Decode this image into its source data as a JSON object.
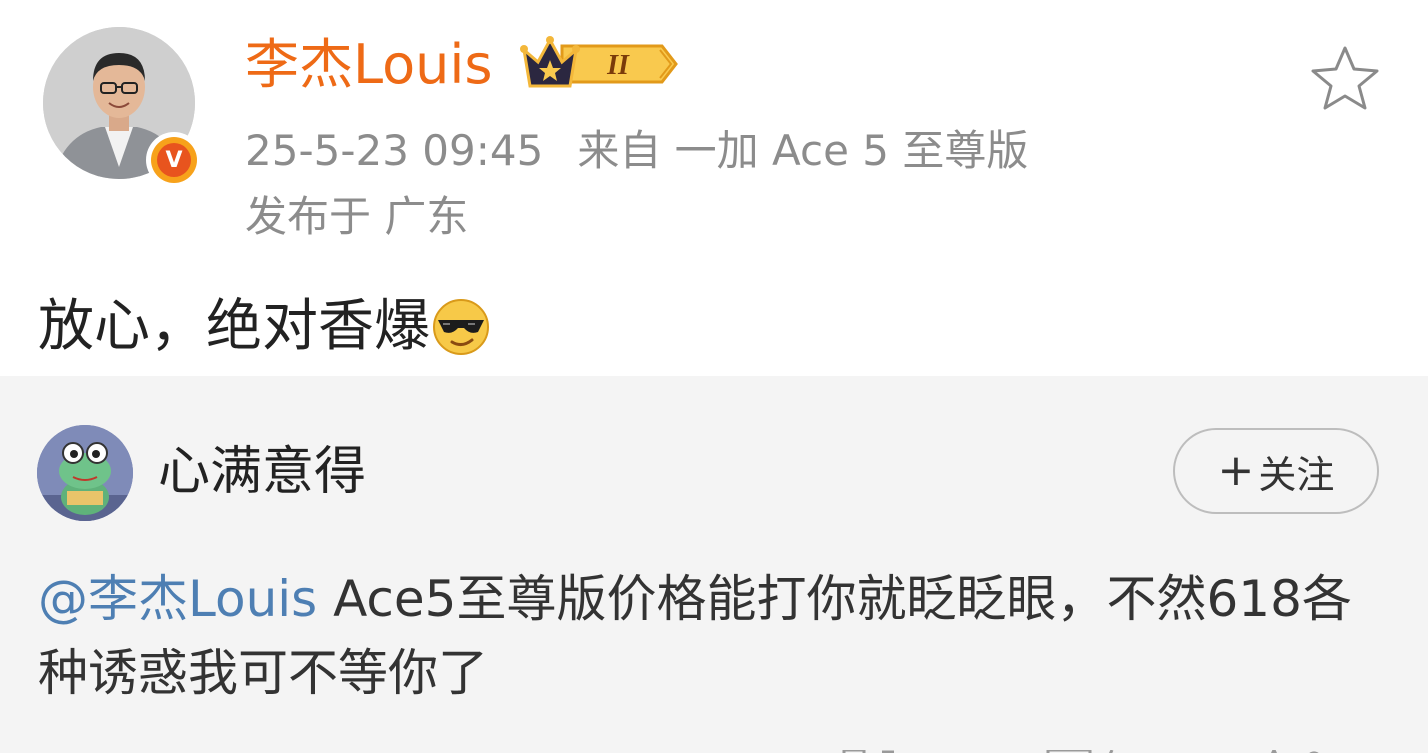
{
  "post": {
    "username": "李杰Louis",
    "vip_level": "II",
    "timestamp": "25-5-23 09:45",
    "source": "来自 一加 Ace 5 至尊版",
    "location": "发布于 广东",
    "text": "放心，绝对香爆",
    "emoji": "sunglasses-emoji",
    "username_color": "#ee6a16"
  },
  "reply": {
    "username": "心满意得",
    "follow_label": "关注",
    "follow_plus": "+",
    "mention": "@李杰Louis",
    "text": " Ace5至尊版价格能打你就眨眨眼，不然618各种诱惑我可不等你了",
    "mention_color": "#4e7fb3"
  }
}
